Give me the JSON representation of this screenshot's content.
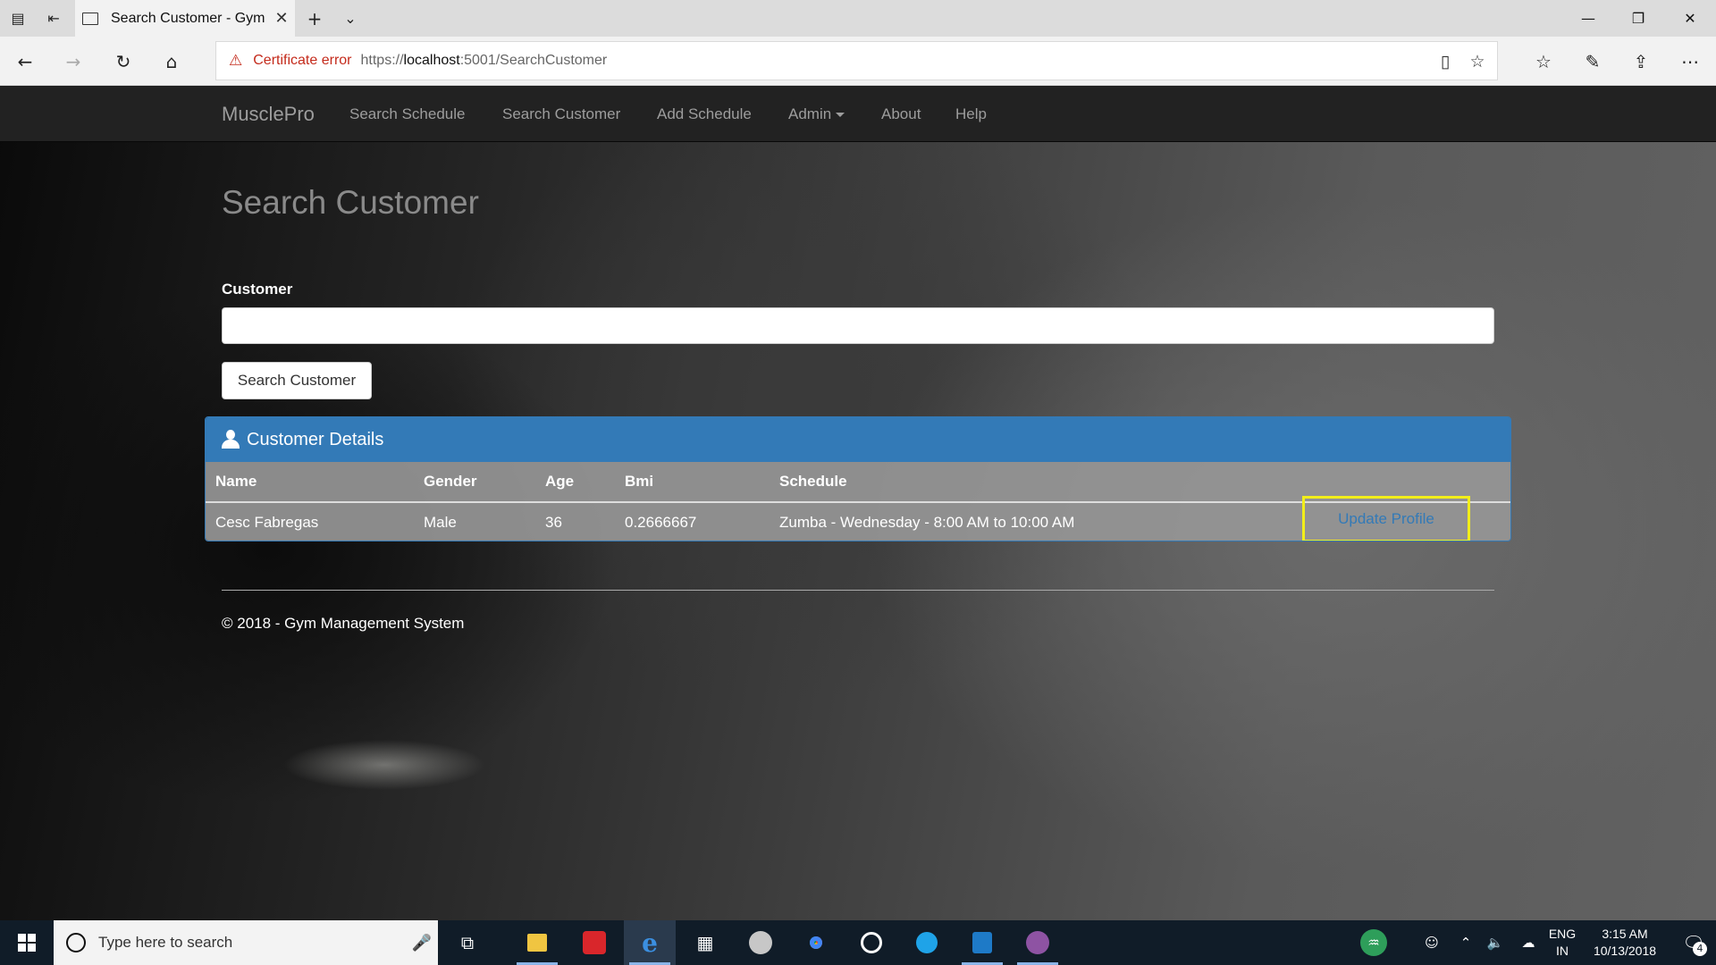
{
  "browser": {
    "tab_title": "Search Customer - Gym",
    "tab_close": "✕",
    "new_tab": "+",
    "tab_menu": "⌄",
    "minimize": "—",
    "restore": "❐",
    "close": "✕",
    "cert_error": "Certificate error",
    "url_scheme": "https://",
    "url_host": "localhost",
    "url_path": ":5001/SearchCustomer",
    "icons": {
      "back": "←",
      "forward": "→",
      "refresh": "↻",
      "home": "⌂",
      "warning": "⚠",
      "reading_view": "▯",
      "favorite": "☆",
      "favorites_hub": "☆",
      "notes": "✎",
      "share": "⇪",
      "more": "⋯",
      "tab_list": "▤",
      "set_aside": "⇤"
    }
  },
  "navbar": {
    "brand": "MusclePro",
    "links": [
      "Search Schedule",
      "Search Customer",
      "Add Schedule",
      "Admin",
      "About",
      "Help"
    ]
  },
  "main": {
    "title": "Search Customer",
    "customer_label": "Customer",
    "customer_value": "",
    "search_button": "Search Customer"
  },
  "panel": {
    "title": "Customer Details",
    "columns": [
      "Name",
      "Gender",
      "Age",
      "Bmi",
      "Schedule"
    ],
    "rows": [
      {
        "name": "Cesc Fabregas",
        "gender": "Male",
        "age": "36",
        "bmi": "0.2666667",
        "schedule": "Zumba - Wednesday - 8:00 AM to 10:00 AM",
        "action": "Update Profile"
      }
    ],
    "highlight_color": "#f2ee1a",
    "header_color": "#337ab7"
  },
  "footer": {
    "text": "© 2018 - Gym Management System"
  },
  "taskbar": {
    "search_placeholder": "Type here to search",
    "mic": "🎤",
    "lang_top": "ENG",
    "lang_bottom": "IN",
    "time": "3:15 AM",
    "date": "10/13/2018",
    "notification_count": "4",
    "icons": {
      "task_view": "⧉",
      "file_explorer": "📁",
      "calculator": "▦",
      "people": "☺",
      "show_hidden": "⌃",
      "volume": "🔈",
      "onedrive": "☁",
      "action_center": "🗨",
      "pulse": "♒"
    }
  }
}
